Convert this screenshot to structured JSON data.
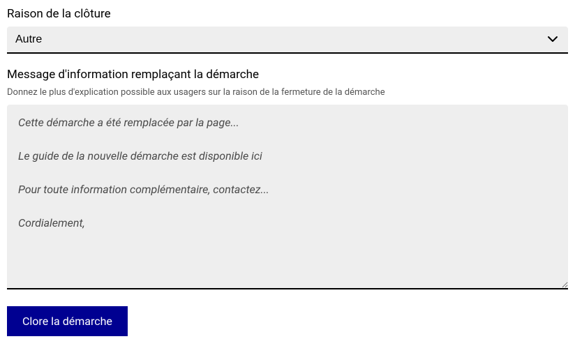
{
  "reason": {
    "label": "Raison de la clôture",
    "selected": "Autre"
  },
  "message": {
    "label": "Message d'information remplaçant la démarche",
    "helper": "Donnez le plus d'explication possible aux usagers sur la raison de la fermeture de la démarche",
    "placeholder": "Cette démarche a été remplacée par la page...\n\nLe guide de la nouvelle démarche est disponible ici\n\nPour toute information complémentaire, contactez...\n\nCordialement,"
  },
  "submit": {
    "label": "Clore la démarche"
  }
}
